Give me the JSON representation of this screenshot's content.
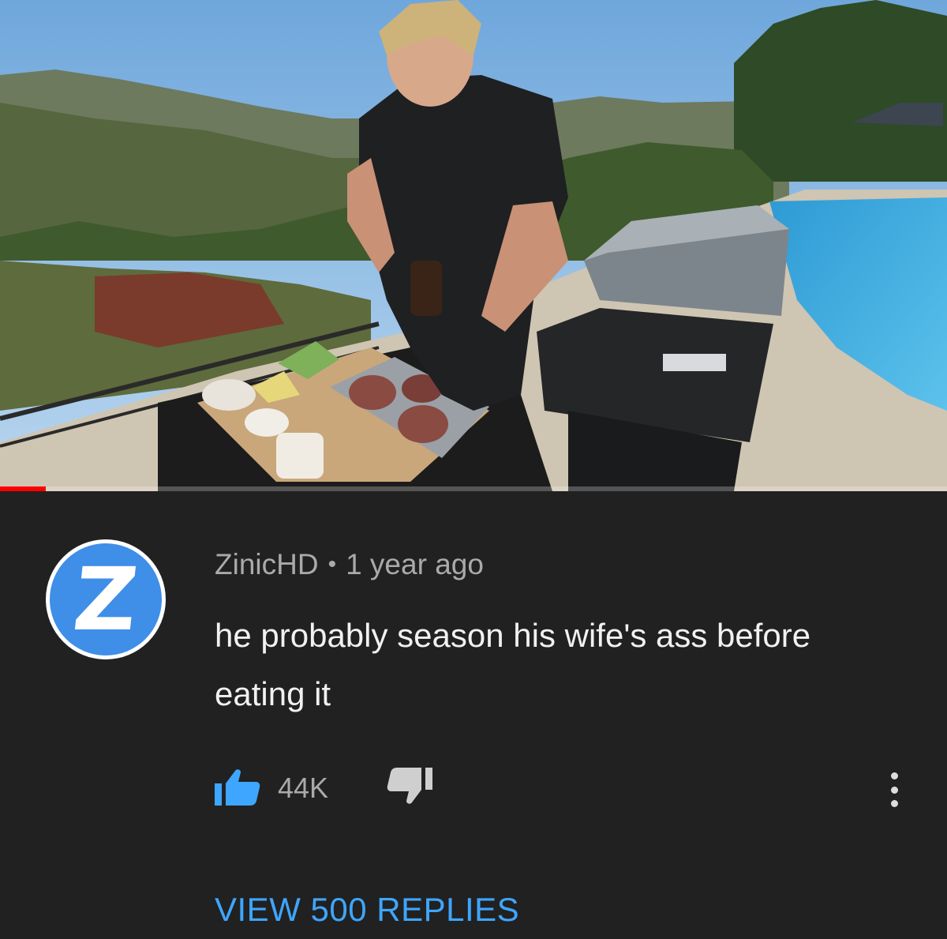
{
  "video": {
    "progress_fraction": 0.048,
    "colors": {
      "progress": "#ff0000"
    }
  },
  "comment": {
    "avatar_letter": "Z",
    "author": "ZinicHD",
    "separator": "•",
    "timestamp": "1 year ago",
    "text": "he probably season his wife's ass before eating it",
    "likes": "44K",
    "like_icon": "thumbs-up-icon",
    "dislike_icon": "thumbs-down-icon",
    "more_icon": "more-vertical-icon",
    "view_replies_label": "VIEW 500 REPLIES"
  },
  "colors": {
    "background": "#212121",
    "accent": "#3ea6ff",
    "avatar": "#3f8ee8",
    "meta_text": "#aaaaaa",
    "body_text": "#f1f1f1"
  }
}
